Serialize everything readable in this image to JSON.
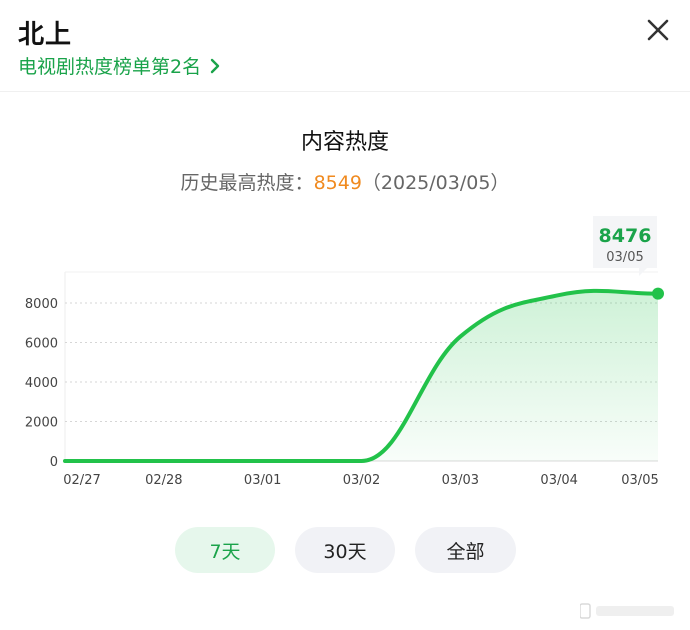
{
  "header": {
    "title": "北上",
    "rank_text": "电视剧热度榜单第2名",
    "close_icon": "close-icon",
    "chevron_icon": "chevron-right-icon"
  },
  "content": {
    "section_title": "内容热度",
    "history_label": "历史最高热度：",
    "history_value": "8549",
    "history_date": "（2025/03/05）"
  },
  "tooltip": {
    "value": "8476",
    "date": "03/05"
  },
  "tabs": [
    {
      "label": "7天",
      "active": true
    },
    {
      "label": "30天",
      "active": false
    },
    {
      "label": "全部",
      "active": false
    }
  ],
  "colors": {
    "accent": "#1aa34a",
    "line": "#22c24a",
    "highlight": "#f08a1f"
  },
  "chart_data": {
    "type": "area",
    "categories": [
      "02/27",
      "02/28",
      "03/01",
      "03/02",
      "03/03",
      "03/04",
      "03/05"
    ],
    "x": [
      "02/27",
      "02/28",
      "03/01",
      "03/02",
      "03/03",
      "03/04",
      "03/05"
    ],
    "series": [
      {
        "values": [
          0,
          0,
          0,
          0,
          6300,
          8400,
          8476
        ]
      }
    ],
    "ylim": [
      0,
      8000
    ],
    "yticks": [
      0,
      2000,
      4000,
      6000,
      8000
    ],
    "grid": true
  }
}
